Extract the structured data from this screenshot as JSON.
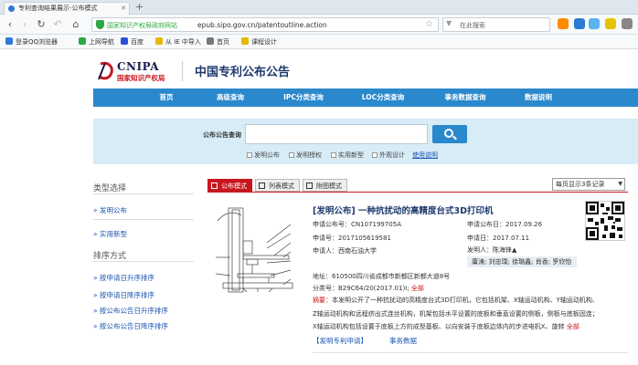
{
  "browser": {
    "tab_title": "专利查询结果展示-公布模式",
    "new_tab": "+",
    "site_name": "国家知识产权局政府网站",
    "url": "epub.sipo.gov.cn/patentoutline.action",
    "search_placeholder": "在此搜索",
    "bookmarks": [
      "登录QQ浏览器",
      "上网导航",
      "百度",
      "从 IE 中导入",
      "首页",
      "课程设计"
    ]
  },
  "header": {
    "logo_text": "CNIPA",
    "logo_subtitle": "国家知识产权局",
    "title": "中国专利公布公告"
  },
  "nav": [
    "首页",
    "高级查询",
    "IPC分类查询",
    "LOC分类查询",
    "事务数据查询",
    "数据说明"
  ],
  "search": {
    "label": "公布公告查询",
    "input_value": "",
    "checkboxes": [
      "发明公布",
      "发明授权",
      "实用新型",
      "外观设计"
    ],
    "help_link": "使用说明"
  },
  "sidebar": {
    "type_heading": "类型选择",
    "type_items": [
      "发明公布",
      "实用新型"
    ],
    "sort_heading": "排序方式",
    "sort_items": [
      "按申请日升序排序",
      "按申请日降序排序",
      "按公布公告日升序排序",
      "按公布公告日降序排序"
    ]
  },
  "results_toolbar": {
    "modes": [
      "公布模式",
      "列表模式",
      "附图模式"
    ],
    "per_page": "每页显示3条记录"
  },
  "result": {
    "title": "[发明公布] 一种抗扰动的高精度台式3D打印机",
    "pub_no": "申请公布号：CN107199705A",
    "pub_date": "申请公布日：2017.09.26",
    "app_no": "申请号：2017105619581",
    "app_date": "申请日：2017.07.11",
    "applicant": "申请人：西南石油大学",
    "inventor": "发明人：陈海锋▲",
    "inventors_expanded": "庸涛; 刘忠璞; 徐璐鑫; 肖香; 罗欣怡",
    "address": "地址：610500四川省成都市新都区新都大道8号",
    "class_no": "分类号：B29C64/20(2017.01)I;",
    "class_more": "全部",
    "abstract_label": "摘要：",
    "abstract_line1": "本发明公开了一种抗扰动的高精度台式3D打印机，它包括机架、X轴运动机构、Y轴运动机构、",
    "abstract_line2": "Z轴运动机构和远程挤出式连丝机构，机架包括水平设置的底板和垂直设置的侧板，侧板与底板固连；",
    "abstract_line3": "X轴运动机构包括设置于底板上方的成型基板、以向安装于底板边体内的步进电机X、旋转",
    "abstract_more": "全部",
    "link_apply": "【发明专利申请】",
    "link_affairs": "事务数据"
  }
}
